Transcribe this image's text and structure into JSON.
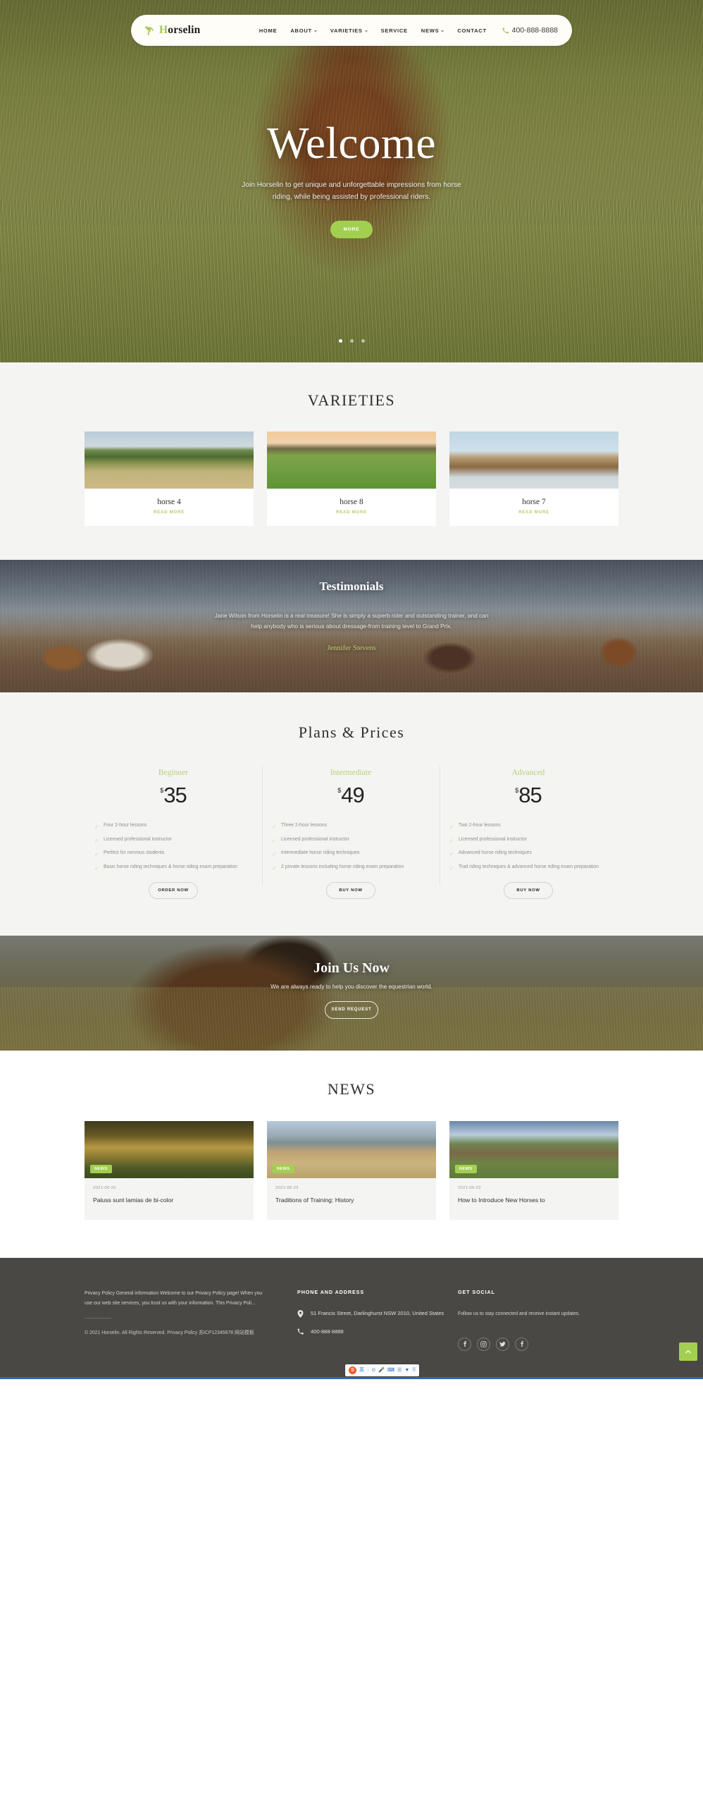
{
  "nav": {
    "brand": {
      "prefix": "H",
      "rest": "orselin",
      "logo_icon": "horse-logo-icon"
    },
    "items": [
      {
        "label": "HOME",
        "has_caret": false
      },
      {
        "label": "ABOUT",
        "has_caret": true
      },
      {
        "label": "VARIETIES",
        "has_caret": true
      },
      {
        "label": "SERVICE",
        "has_caret": false
      },
      {
        "label": "NEWS",
        "has_caret": true
      },
      {
        "label": "CONTACT",
        "has_caret": false
      }
    ],
    "phone": "400-888-8888",
    "phone_icon": "phone-icon"
  },
  "hero": {
    "title": "Welcome",
    "subtitle": "Join Horselin to get unique and unforgettable impressions from horse riding, while being assisted by professional riders.",
    "button": "MORE",
    "slides": 3,
    "active_slide": 0
  },
  "varieties": {
    "title": "VARIETIES",
    "cards": [
      {
        "title": "horse 4",
        "link": "READ MORE",
        "image_alt": "three-horses-in-mountain-meadow"
      },
      {
        "title": "horse 8",
        "link": "READ MORE",
        "image_alt": "two-horses-grazing-by-fence"
      },
      {
        "title": "horse 7",
        "link": "READ MORE",
        "image_alt": "palomino-horse-portrait"
      }
    ]
  },
  "testimonials": {
    "title": "Testimonials",
    "quote": "Jane Wilson from Horselin is a real treasure! She is simply a superb rider and outstanding trainer, and can help anybody who is serious about dressage-from training level to Grand Prix.",
    "author": "Jennifer Stevens"
  },
  "plans": {
    "title": "Plans & Prices",
    "items": [
      {
        "name": "Beginner",
        "currency": "$",
        "amount": "35",
        "features": [
          "Four 2-hour lessons",
          "Licensed professional instructor",
          "Perfect for nervous students",
          "Basic horse riding techniques & horse riding exam preparation"
        ],
        "button": "ORDER NOW"
      },
      {
        "name": "Intermediate",
        "currency": "$",
        "amount": "49",
        "features": [
          "Three 2-hour lessons",
          "Licensed professional instructor",
          "Intermediate horse riding techniques",
          "2 private lessons including horse riding exam preparation"
        ],
        "button": "BUY NOW"
      },
      {
        "name": "Advanced",
        "currency": "$",
        "amount": "85",
        "features": [
          "Two 2-hour lessons",
          "Licensed professional instructor",
          "Advanced horse riding techniques",
          "Trail riding techniques & advanced horse riding exam preparation"
        ],
        "button": "BUY NOW"
      }
    ]
  },
  "joinus": {
    "title": "Join Us Now",
    "subtitle": "We are always ready to help you discover the equestrian world.",
    "button": "SEND REQUEST"
  },
  "news": {
    "title": "NEWS",
    "cards": [
      {
        "badge": "NEWS",
        "date": "2021-06-26",
        "title": "Paluss sunt lamias de bi-color",
        "image_alt": "horse-at-sunset-behind-fence"
      },
      {
        "badge": "NEWS",
        "date": "2021-06-23",
        "title": "Traditions of Training: History",
        "image_alt": "rider-on-horse-in-field"
      },
      {
        "badge": "NEWS",
        "date": "2021-06-23",
        "title": "How to Introduce New Horses to",
        "image_alt": "two-horses-in-green-pasture"
      }
    ]
  },
  "footer": {
    "about_text": "Privacy Policy General information Welcome to our Privacy Policy page! When you use our web site services, you trust us with your information. This Privacy Poli...",
    "copyright": "© 2021 Horselin. All Rights Reserved. Privacy Policy 苏ICP12345678 网站模板",
    "contact_heading": "PHONE AND ADDRESS",
    "address": "51 Francis Street, Darlinghurst NSW 2010, United States",
    "phone": "400-888-8888",
    "social_heading": "GET SOCIAL",
    "social_text": "Follow us to stay connected and receive instant updates.",
    "socials": [
      {
        "name": "facebook-icon",
        "glyph": "f"
      },
      {
        "name": "instagram-icon",
        "glyph": "◎"
      },
      {
        "name": "twitter-icon",
        "glyph": "t"
      },
      {
        "name": "facebook-alt-icon",
        "glyph": "f"
      }
    ]
  },
  "colors": {
    "accent": "#a3cf51",
    "accent_light": "#b6d171",
    "footer_bg": "#4a4845",
    "section_bg": "#f4f4f2"
  },
  "ime": {
    "logo": "S",
    "items": [
      "英",
      "·",
      "⊙",
      "🎤",
      "⌨",
      "☰",
      "▼",
      "⠿"
    ]
  },
  "to_top": "scroll-to-top"
}
